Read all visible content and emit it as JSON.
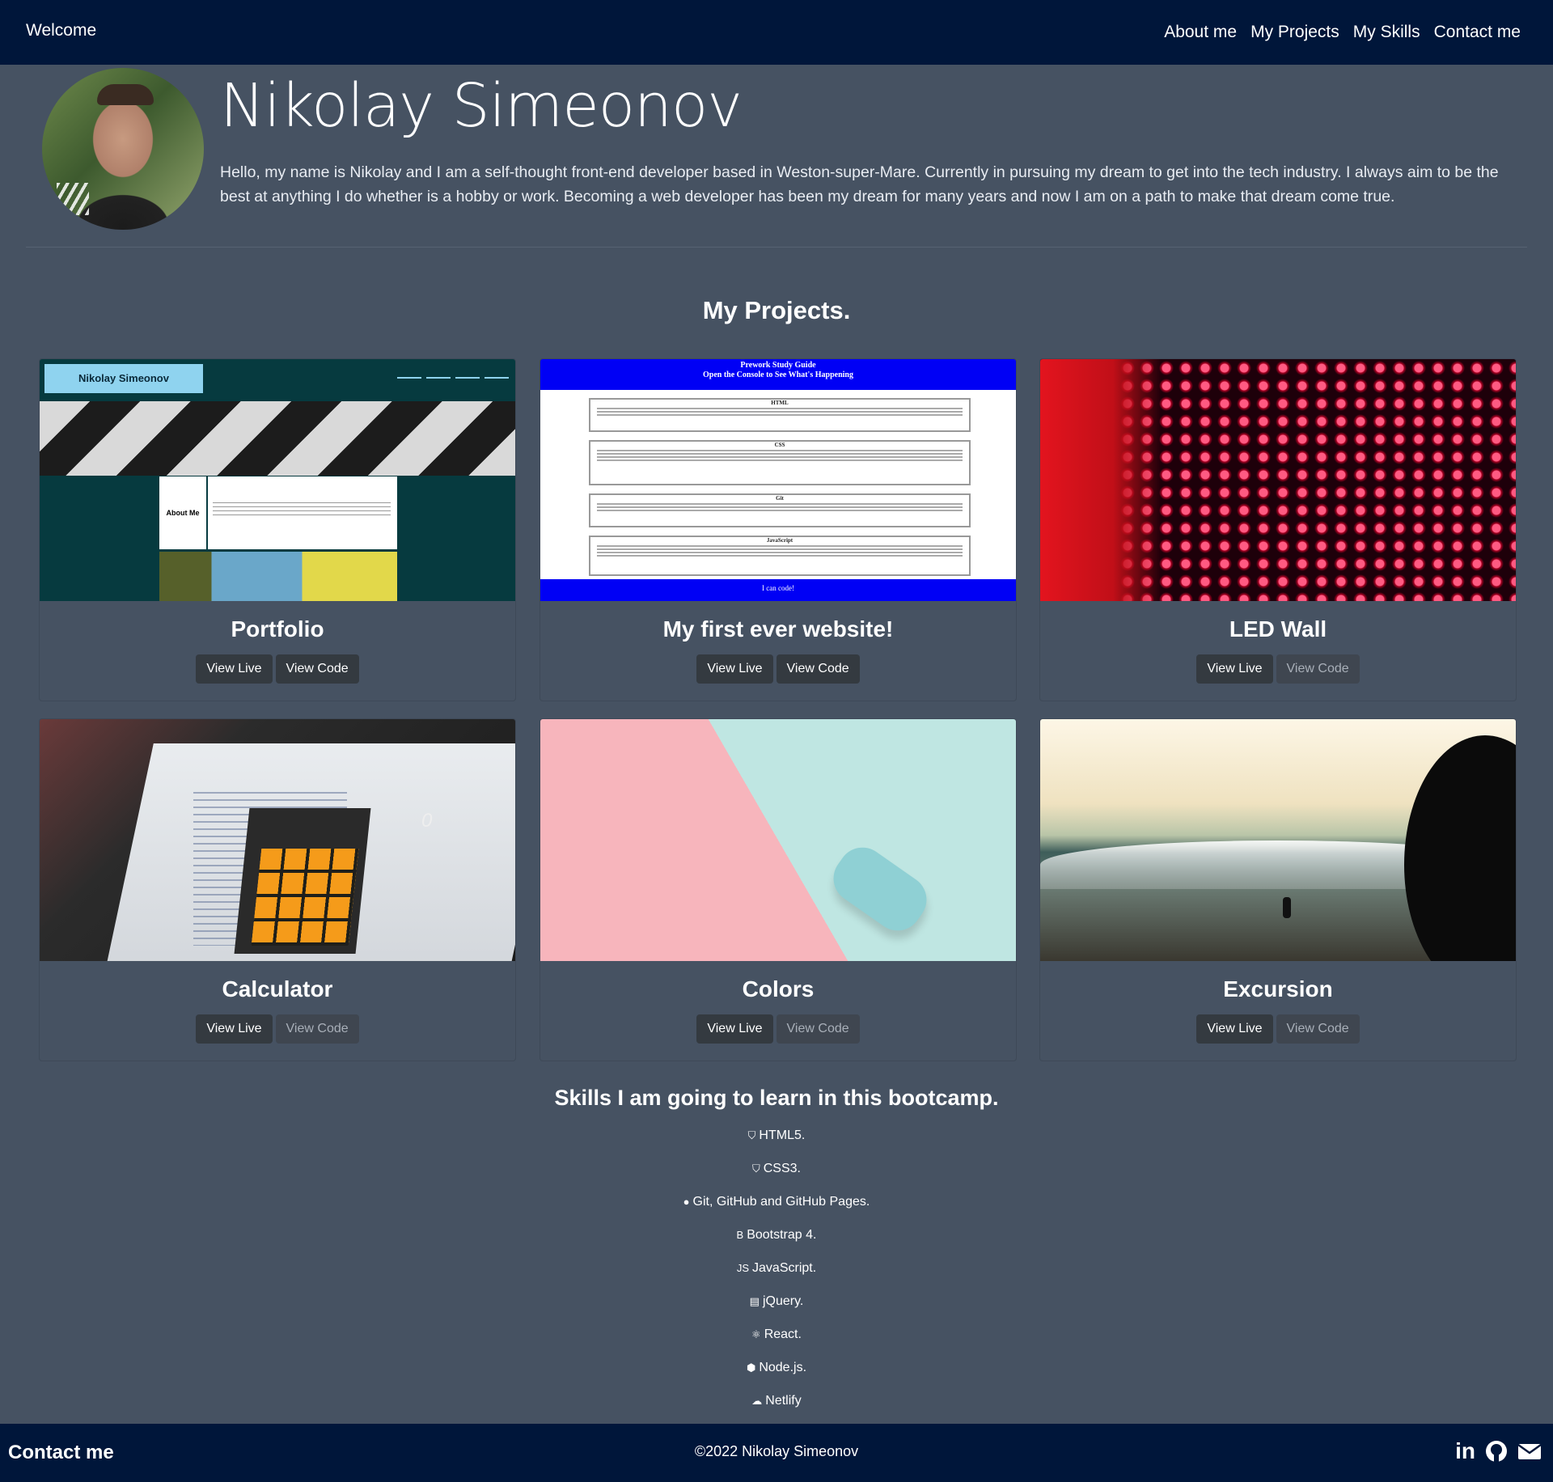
{
  "nav": {
    "brand": "Welcome",
    "links": [
      "About me",
      "My Projects",
      "My Skills",
      "Contact me"
    ]
  },
  "hero": {
    "name": "Nikolay Simeonov",
    "bio": "Hello, my name is Nikolay and I am a self-thought front-end developer based in Weston-super-Mare. Currently in pursuing my dream to get into the tech industry. I always aim to be the best at anything I do whether is a hobby or work. Becoming a web developer has been my dream for many years and now I am on a path to make that dream come true."
  },
  "projects": {
    "title": "My Projects.",
    "items": [
      {
        "title": "Portfolio",
        "live": "View Live",
        "code": "View Code"
      },
      {
        "title": "My first ever website!",
        "live": "View Live",
        "code": "View Code"
      },
      {
        "title": "LED Wall",
        "live": "View Live",
        "code": "View Code"
      },
      {
        "title": "Calculator",
        "live": "View Live",
        "code": "View Code"
      },
      {
        "title": "Colors",
        "live": "View Live",
        "code": "View Code"
      },
      {
        "title": "Excursion",
        "live": "View Live",
        "code": "View Code"
      }
    ],
    "thumbs": {
      "portfolio_header": "Nikolay Simeonov",
      "portfolio_about": "About Me",
      "first_title": "Prework Study Guide",
      "first_subtitle": "Open the Console to See What's Happening",
      "first_sections": [
        "HTML",
        "CSS",
        "Git",
        "JavaScript"
      ],
      "first_footer": "I can code!",
      "calc_display": "0"
    }
  },
  "skills": {
    "title": "Skills I am going to learn in this bootcamp.",
    "items": [
      {
        "label": "HTML5.",
        "icon": "html5-icon",
        "glyph": "⛉"
      },
      {
        "label": "CSS3.",
        "icon": "css3-icon",
        "glyph": "⛉"
      },
      {
        "label": "Git, GitHub and GitHub Pages.",
        "icon": "github-icon",
        "glyph": "●"
      },
      {
        "label": "Bootstrap 4.",
        "icon": "bootstrap-icon",
        "glyph": "B"
      },
      {
        "label": "JavaScript.",
        "icon": "javascript-icon",
        "glyph": "JS"
      },
      {
        "label": "jQuery.",
        "icon": "jquery-icon",
        "glyph": "▤"
      },
      {
        "label": "React.",
        "icon": "react-icon",
        "glyph": "⚛"
      },
      {
        "label": "Node.js.",
        "icon": "nodejs-icon",
        "glyph": "⬢"
      },
      {
        "label": "Netlify",
        "icon": "cloud-icon",
        "glyph": "☁"
      }
    ]
  },
  "footer": {
    "contact": "Contact me",
    "copyright": "©2022 Nikolay Simeonov",
    "icons": [
      "linkedin-icon",
      "github-icon",
      "email-icon"
    ],
    "linkedin_text": "in"
  },
  "colors": {
    "navbar": "#00163a",
    "background": "#465262",
    "button": "#343a40"
  }
}
